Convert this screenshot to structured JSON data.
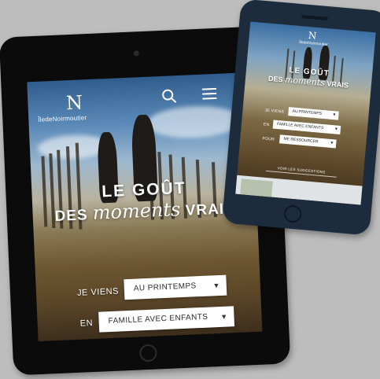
{
  "site": {
    "logo_text": "ÎledeNoirmoutier",
    "logo_mark": "N",
    "icons": {
      "search": "search-icon",
      "menu": "hamburger-menu-icon"
    }
  },
  "hero": {
    "headline_line1": "LE GOÛT",
    "headline_des": "DES",
    "headline_moments": "moments",
    "headline_vrais": "VRAIS"
  },
  "form": {
    "rows": [
      {
        "label": "JE VIENS",
        "value": "AU PRINTEMPS"
      },
      {
        "label": "EN",
        "value": "FAMILLE AVEC ENFANTS"
      },
      {
        "label": "POUR",
        "value": "ME RESSOURCER"
      }
    ]
  },
  "phone": {
    "cta": "VOIR LES SUGGESTIONS"
  },
  "colors": {
    "background": "#bdbdbd",
    "tablet_bezel": "#0b0b0b",
    "phone_bezel": "#1d2c3c",
    "text": "#ffffff"
  }
}
